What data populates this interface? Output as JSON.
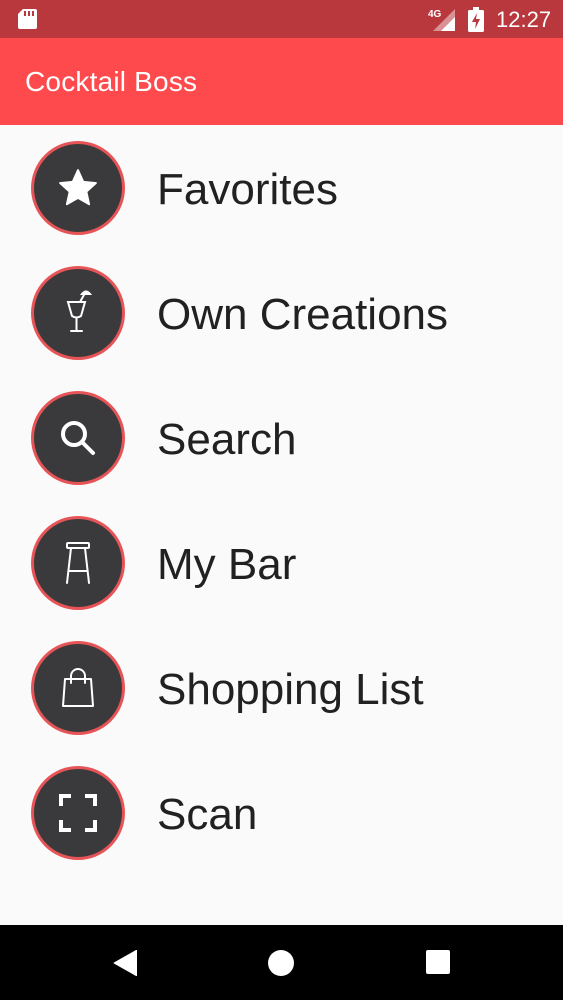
{
  "status_bar": {
    "network": "4G",
    "time": "12:27",
    "icons": [
      "sd-card-icon",
      "signal-icon",
      "battery-charging-icon"
    ]
  },
  "app_bar": {
    "title": "Cocktail Boss"
  },
  "menu": {
    "items": [
      {
        "label": "Favorites",
        "icon": "star-icon"
      },
      {
        "label": "Own Creations",
        "icon": "cocktail-glass-icon"
      },
      {
        "label": "Search",
        "icon": "search-icon"
      },
      {
        "label": "My Bar",
        "icon": "bar-stool-icon"
      },
      {
        "label": "Shopping List",
        "icon": "shopping-bag-icon"
      },
      {
        "label": "Scan",
        "icon": "scan-frame-icon"
      }
    ]
  },
  "nav_bar": {
    "icons": [
      "back-icon",
      "home-icon",
      "recents-icon"
    ]
  },
  "colors": {
    "status_bar": "#b8383d",
    "app_bar": "#fe4a4d",
    "icon_circle": "#3a3a3c",
    "icon_ring": "#e65457",
    "label_text": "#212121",
    "background": "#fafafa"
  }
}
